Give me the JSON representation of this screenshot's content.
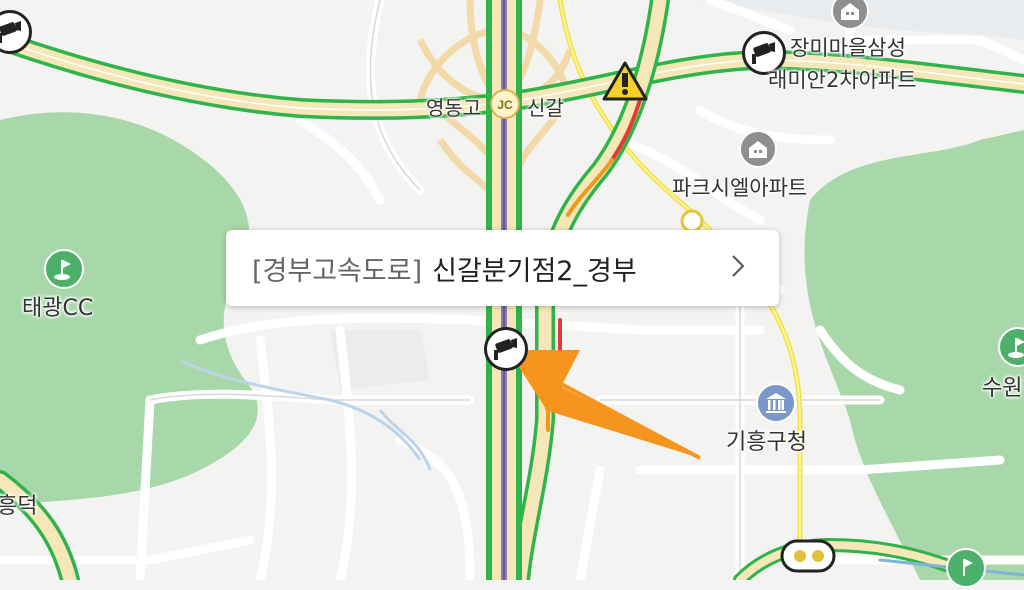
{
  "popup": {
    "prefix": "[경부고속도로]",
    "name": "신갈분기점2_경부"
  },
  "labels": {
    "junction_left": "영동고",
    "junction_badge": "JC",
    "junction_right": "신갈",
    "apartment1_line1": "장미마을삼성",
    "apartment1_line2": "래미안2차아파트",
    "apartment2": "파크시엘아파트",
    "golf": "태광CC",
    "district_office": "기흥구청",
    "place_left": "흥덕",
    "place_right": "수원"
  },
  "icons": [
    "cctv-camera-icon",
    "warning-icon",
    "apartment-icon",
    "golf-icon",
    "government-icon",
    "current-location-arrow-icon",
    "chevron-right-icon",
    "traffic-light-icon"
  ],
  "colors": {
    "traffic_smooth": "#2fb34a",
    "traffic_slow": "#f09a1d",
    "traffic_jam": "#e53935",
    "highway_fill": "#f5e7b8",
    "park": "#9fd4a4",
    "location_arrow": "#f7941d",
    "gov_icon": "#7b96c9"
  }
}
